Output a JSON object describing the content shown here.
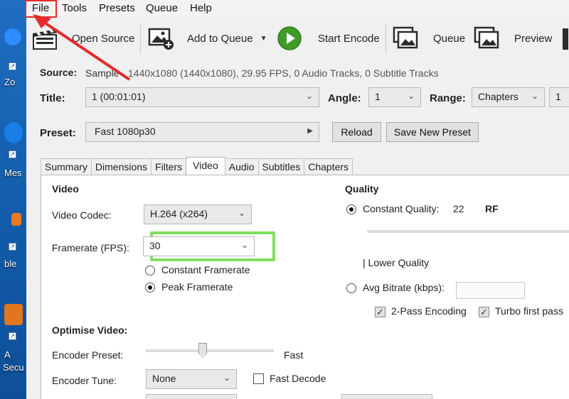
{
  "menu": {
    "file": "File",
    "tools": "Tools",
    "presets": "Presets",
    "queue": "Queue",
    "help": "Help"
  },
  "toolbar": {
    "open_source": "Open Source",
    "add_to_queue": "Add to Queue",
    "start_encode": "Start Encode",
    "queue": "Queue",
    "preview": "Preview"
  },
  "source": {
    "label": "Source:",
    "name": "Sample",
    "details": "1440x1080 (1440x1080), 29.95 FPS, 0 Audio Tracks, 0 Subtitle Tracks"
  },
  "title": {
    "label": "Title:",
    "value": "1 (00:01:01)"
  },
  "angle": {
    "label": "Angle:",
    "value": "1"
  },
  "range": {
    "label": "Range:",
    "value": "Chapters",
    "start": "1"
  },
  "preset": {
    "label": "Preset:",
    "value": "Fast 1080p30",
    "reload": "Reload",
    "save_new": "Save New Preset"
  },
  "tabs": [
    "Summary",
    "Dimensions",
    "Filters",
    "Video",
    "Audio",
    "Subtitles",
    "Chapters"
  ],
  "video": {
    "heading": "Video",
    "codec_label": "Video Codec:",
    "codec_value": "H.264 (x264)",
    "framerate_label": "Framerate (FPS):",
    "framerate_value": "30",
    "constant_framerate": "Constant Framerate",
    "peak_framerate": "Peak Framerate"
  },
  "quality": {
    "heading": "Quality",
    "constant_quality": "Constant Quality:",
    "cq_value": "22",
    "cq_unit": "RF",
    "lower_quality": "| Lower Quality",
    "avg_bitrate": "Avg Bitrate (kbps):",
    "two_pass": "2-Pass Encoding",
    "turbo": "Turbo first pass"
  },
  "optimise": {
    "heading": "Optimise Video:",
    "encoder_preset_label": "Encoder Preset:",
    "encoder_preset_value": "Fast",
    "encoder_tune_label": "Encoder Tune:",
    "encoder_tune_value": "None",
    "fast_decode": "Fast Decode"
  },
  "desktop": {
    "labels": [
      "Zo",
      "Mes",
      "ble",
      "A",
      "Secu"
    ]
  },
  "colors": {
    "annotation_red": "#e52b2b",
    "highlight_green": "#7fe05e",
    "play_green": "#3f9b2a"
  }
}
